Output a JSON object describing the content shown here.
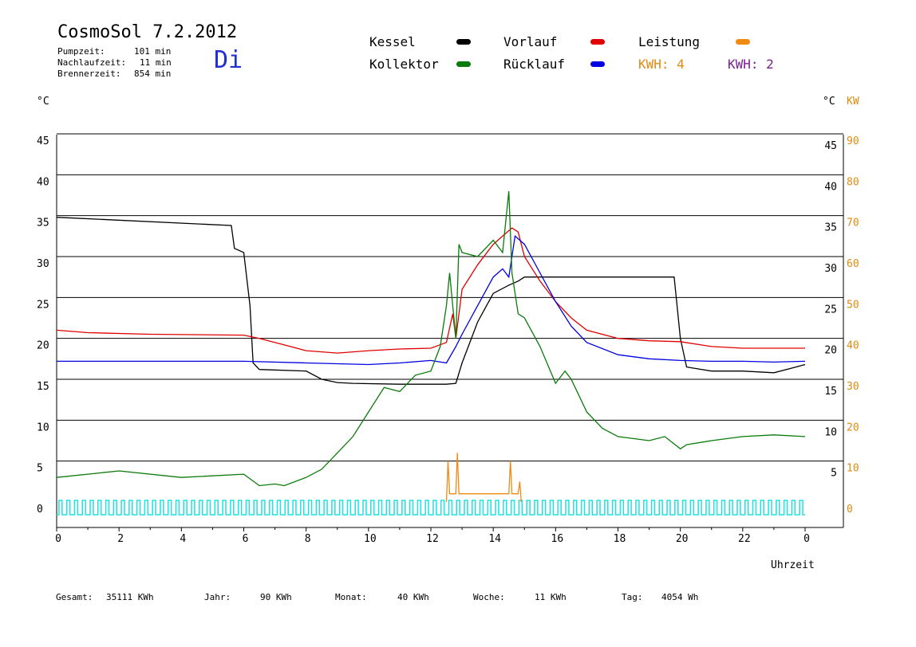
{
  "header": {
    "title": "CosmoSol 7.2.2012",
    "day": "Di",
    "stats": [
      {
        "label": "Pumpzeit:",
        "value": "101 min"
      },
      {
        "label": "Nachlaufzeit:",
        "value": "11 min"
      },
      {
        "label": "Brennerzeit:",
        "value": "854 min"
      }
    ]
  },
  "legend": {
    "kessel": {
      "label": "Kessel",
      "color": "#000000"
    },
    "kollektor": {
      "label": "Kollektor",
      "color": "#0a7a0a"
    },
    "vorlauf": {
      "label": "Vorlauf",
      "color": "#e00000"
    },
    "ruecklauf": {
      "label": "Rücklauf",
      "color": "#0000e0"
    },
    "leistung": {
      "label": "Leistung",
      "color": "#f08a10"
    },
    "kwh1": {
      "label": "KWH: 4",
      "color": "#e08a10"
    },
    "kwh2": {
      "label": "KWH: 2",
      "color": "#7a2090"
    }
  },
  "axes": {
    "left_unit": "°C",
    "right_unit": "°C",
    "right_unit2": "KW",
    "xlabel": "Uhrzeit"
  },
  "footer": {
    "gesamt": {
      "label": "Gesamt:",
      "value": "35111 KWh"
    },
    "jahr": {
      "label": "Jahr:",
      "value": "90 KWh"
    },
    "monat": {
      "label": "Monat:",
      "value": "40 KWh"
    },
    "woche": {
      "label": "Woche:",
      "value": "11 KWh"
    },
    "tag": {
      "label": "Tag:",
      "value": "4054 Wh"
    }
  },
  "chart_data": {
    "type": "line",
    "xlim": [
      0,
      24
    ],
    "ylim": [
      0,
      45
    ],
    "y2lim": [
      0,
      90
    ],
    "x_tick_labels": [
      "0",
      "2",
      "4",
      "6",
      "8",
      "10",
      "12",
      "14",
      "16",
      "18",
      "20",
      "22",
      "0"
    ],
    "y_tick_labels": [
      "0",
      "5",
      "10",
      "15",
      "20",
      "25",
      "30",
      "35",
      "40",
      "45"
    ],
    "y_right_tick_labels": [
      "5",
      "10",
      "15",
      "20",
      "25",
      "30",
      "35",
      "40",
      "45"
    ],
    "y2_tick_labels": [
      "0",
      "10",
      "20",
      "30",
      "40",
      "50",
      "60",
      "70",
      "80",
      "90"
    ],
    "grid": true,
    "series": [
      {
        "name": "Kessel",
        "color": "#000000",
        "x": [
          0,
          5.6,
          5.7,
          6.0,
          6.2,
          6.3,
          6.5,
          8.0,
          8.5,
          9.0,
          9.5,
          11.0,
          12.0,
          12.5,
          12.8,
          13.0,
          13.5,
          14.0,
          14.5,
          14.8,
          15.0,
          16.0,
          17.0,
          18.0,
          19.0,
          19.5,
          19.8,
          20.0,
          20.2,
          21.0,
          22.0,
          23.0,
          23.5,
          24.0
        ],
        "y": [
          34.8,
          33.8,
          31.0,
          30.5,
          24.0,
          17.0,
          16.2,
          16.0,
          15.0,
          14.6,
          14.5,
          14.4,
          14.4,
          14.4,
          14.5,
          17.0,
          22.0,
          25.5,
          26.5,
          27.0,
          27.5,
          27.5,
          27.5,
          27.5,
          27.5,
          27.5,
          27.5,
          20.0,
          16.5,
          16.0,
          16.0,
          15.8,
          16.3,
          16.8
        ]
      },
      {
        "name": "Vorlauf",
        "color": "#e00000",
        "x": [
          0,
          1.0,
          3.0,
          6.0,
          6.5,
          7.5,
          8.0,
          9.0,
          10.0,
          11.0,
          12.0,
          12.5,
          12.7,
          12.8,
          13.0,
          13.5,
          14.0,
          14.3,
          14.6,
          14.8,
          15.0,
          15.5,
          16.0,
          16.5,
          17.0,
          18.0,
          19.0,
          20.0,
          21.0,
          22.0,
          23.0,
          24.0
        ],
        "y": [
          21.0,
          20.7,
          20.5,
          20.4,
          20.0,
          19.0,
          18.5,
          18.2,
          18.5,
          18.7,
          18.8,
          19.5,
          23.0,
          20.0,
          26.0,
          29.0,
          31.5,
          32.5,
          33.5,
          33.0,
          30.0,
          27.0,
          24.5,
          22.5,
          21.0,
          20.0,
          19.7,
          19.6,
          19.0,
          18.8,
          18.8,
          18.8
        ]
      },
      {
        "name": "Rücklauf",
        "color": "#0000e0",
        "x": [
          0,
          3.0,
          6.0,
          8.0,
          10.0,
          11.0,
          12.0,
          12.5,
          12.8,
          13.0,
          13.5,
          14.0,
          14.3,
          14.5,
          14.7,
          15.0,
          15.5,
          16.0,
          16.5,
          17.0,
          18.0,
          19.0,
          20.0,
          21.0,
          22.0,
          23.0,
          24.0
        ],
        "y": [
          17.2,
          17.2,
          17.2,
          17.0,
          16.8,
          17.0,
          17.3,
          17.0,
          19.0,
          20.5,
          24.0,
          27.5,
          28.5,
          27.5,
          32.5,
          31.5,
          28.0,
          24.5,
          21.5,
          19.5,
          18.0,
          17.5,
          17.3,
          17.2,
          17.2,
          17.1,
          17.2
        ]
      },
      {
        "name": "Kollektor",
        "color": "#0a7a0a",
        "x": [
          0,
          2.0,
          4.0,
          6.0,
          6.5,
          7.0,
          7.3,
          8.0,
          8.5,
          9.0,
          9.5,
          10.0,
          10.5,
          11.0,
          11.5,
          12.0,
          12.3,
          12.5,
          12.6,
          12.8,
          12.9,
          13.0,
          13.5,
          14.0,
          14.3,
          14.5,
          14.6,
          14.8,
          15.0,
          15.5,
          16.0,
          16.3,
          16.5,
          17.0,
          17.5,
          18.0,
          19.0,
          19.5,
          20.0,
          20.2,
          21.0,
          22.0,
          23.0,
          24.0
        ],
        "y": [
          3.0,
          3.8,
          3.0,
          3.4,
          2.0,
          2.2,
          2.0,
          3.0,
          4.0,
          6.0,
          8.0,
          11.0,
          14.0,
          13.5,
          15.5,
          16.0,
          19.0,
          24.0,
          28.0,
          20.0,
          31.5,
          30.5,
          30.0,
          32.0,
          30.5,
          38.0,
          28.0,
          23.0,
          22.5,
          19.0,
          14.5,
          16.0,
          15.0,
          11.0,
          9.0,
          8.0,
          7.5,
          8.0,
          6.5,
          7.0,
          7.5,
          8.0,
          8.2,
          8.0
        ]
      }
    ],
    "power_series": {
      "name": "Leistung",
      "color": "#f08a10",
      "x": [
        12.5,
        12.55,
        12.6,
        12.8,
        12.85,
        12.9,
        13.5,
        14.0,
        14.5,
        14.55,
        14.6,
        14.8,
        14.85,
        14.9
      ],
      "y": [
        0,
        10,
        2,
        2,
        12,
        2,
        2,
        2,
        2,
        10,
        2,
        2,
        5,
        0
      ]
    }
  }
}
